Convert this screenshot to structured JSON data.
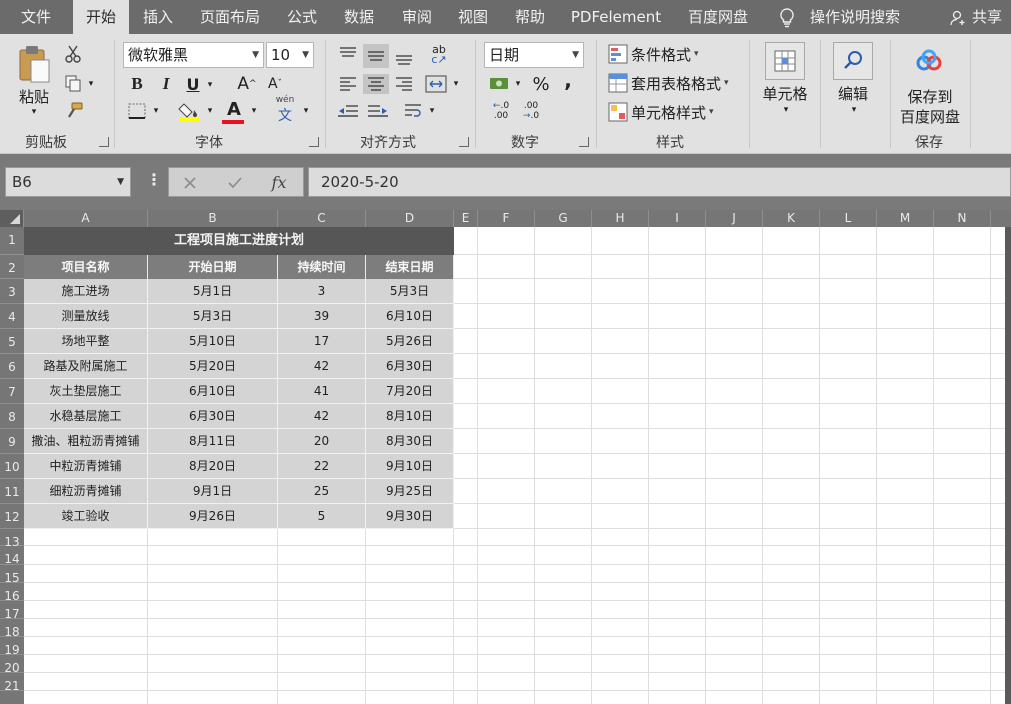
{
  "menu": {
    "tabs": [
      "文件",
      "开始",
      "插入",
      "页面布局",
      "公式",
      "数据",
      "审阅",
      "视图",
      "帮助",
      "PDFelement",
      "百度网盘"
    ],
    "active_tab": "开始",
    "tell_me": "操作说明搜索",
    "share": "共享"
  },
  "ribbon": {
    "clipboard": {
      "paste": "粘贴",
      "label": "剪贴板"
    },
    "font": {
      "name": "微软雅黑",
      "size": "10",
      "bold": "B",
      "italic": "I",
      "underline": "U",
      "grow": "A",
      "shrink": "A",
      "color_letter": "A",
      "phonetic": "文",
      "phonetic_top": "wén",
      "label": "字体"
    },
    "alignment": {
      "label": "对齐方式"
    },
    "number": {
      "format": "日期",
      "percent": "%",
      "comma": ",",
      "label": "数字"
    },
    "styles": {
      "conditional": "条件格式",
      "table": "套用表格格式",
      "cell_styles": "单元格样式",
      "label": "样式"
    },
    "cells": {
      "button": "单元格"
    },
    "editing": {
      "button": "编辑"
    },
    "save": {
      "button_line1": "保存到",
      "button_line2": "百度网盘",
      "label": "保存"
    }
  },
  "formula_bar": {
    "name_box": "B6",
    "fx": "fx",
    "value": "2020-5-20"
  },
  "columns": [
    "A",
    "B",
    "C",
    "D",
    "E",
    "F",
    "G",
    "H",
    "I",
    "J",
    "K",
    "L",
    "M",
    "N"
  ],
  "rows": [
    "1",
    "2",
    "3",
    "4",
    "5",
    "6",
    "7",
    "8",
    "9",
    "10",
    "11",
    "12",
    "13",
    "14",
    "15",
    "16",
    "17",
    "18",
    "19",
    "20",
    "21"
  ],
  "table": {
    "title": "工程项目施工进度计划",
    "headers": [
      "项目名称",
      "开始日期",
      "持续时间",
      "结束日期"
    ],
    "rows": [
      [
        "施工进场",
        "5月1日",
        "3",
        "5月3日"
      ],
      [
        "测量放线",
        "5月3日",
        "39",
        "6月10日"
      ],
      [
        "场地平整",
        "5月10日",
        "17",
        "5月26日"
      ],
      [
        "路基及附属施工",
        "5月20日",
        "42",
        "6月30日"
      ],
      [
        "灰土垫层施工",
        "6月10日",
        "41",
        "7月20日"
      ],
      [
        "水稳基层施工",
        "6月30日",
        "42",
        "8月10日"
      ],
      [
        "撒油、粗粒沥青摊铺",
        "8月11日",
        "20",
        "8月30日"
      ],
      [
        "中粒沥青摊铺",
        "8月20日",
        "22",
        "9月10日"
      ],
      [
        "细粒沥青摊铺",
        "9月1日",
        "25",
        "9月25日"
      ],
      [
        "竣工验收",
        "9月26日",
        "5",
        "9月30日"
      ]
    ]
  }
}
